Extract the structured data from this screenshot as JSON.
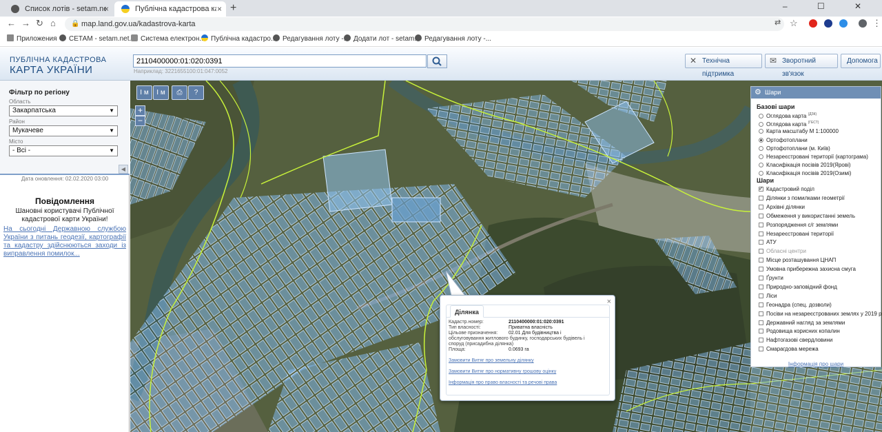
{
  "browser": {
    "tabs": [
      {
        "title": "Список лотів - setam.net.ua",
        "close": "×"
      },
      {
        "title": "Публічна кадастрова карта Укр",
        "close": "×"
      }
    ],
    "new_tab": "+",
    "window_controls": "–   ☐   ✕",
    "url": "map.land.gov.ua/kadastrova-karta",
    "bookmarks": [
      "Приложения",
      "СЕТАМ - setam.net...",
      "Система електрон...",
      "Публічна кадастро...",
      "Редагування лоту -...",
      "Додати лот - setam...",
      "Редагування лоту -..."
    ]
  },
  "header": {
    "logo_line1": "ПУБЛІЧНА КАДАСТРОВА",
    "logo_line2": "КАРТА УКРАЇНИ",
    "search_value": "2110400000:01:020:0391",
    "search_hint": "Наприклад: 3221655100:01:047:0052",
    "buttons": {
      "support": "Технічна підтримка",
      "feedback": "Зворотний зв'язок",
      "help": "Допомога"
    }
  },
  "filter": {
    "title": "Фільтр по регіону",
    "oblast_label": "Область",
    "oblast_value": "Закарпатська",
    "raion_label": "Район",
    "raion_value": "Мукачеве",
    "misto_label": "Місто",
    "misto_value": "- Всі -"
  },
  "update_date": "Дата оновлення: 02.02.2020 03:00",
  "notice": {
    "title": "Повідомлення",
    "greeting": "Шановні користувачі Публічної кадастрової карти України!",
    "body": "На сьогодні Державною службою України з питань геодезії, картографії та кадастру здійснюються заходи із виправлення помилок..."
  },
  "map_tools": [
    "I м",
    "I м",
    "⎙",
    "?"
  ],
  "zoom": {
    "in": "+",
    "out": "−"
  },
  "layers": {
    "title": "Шари",
    "base_title": "Базові шари",
    "base": [
      {
        "label": "Оглядова карта",
        "sup": "(ДЗК)",
        "on": false
      },
      {
        "label": "Оглядова карта",
        "sup": "(ГЕСТ)",
        "on": false
      },
      {
        "label": "Карта масштабу М 1:100000",
        "on": false
      },
      {
        "label": "Ортофотоплани",
        "on": true
      },
      {
        "label": "Ортофотоплани (м. Київ)",
        "on": false
      },
      {
        "label": "Незареєстровані території (картограма)",
        "on": false
      },
      {
        "label": "Класифікація посівів 2019(Ярові)",
        "on": false
      },
      {
        "label": "Класифікація посівів 2019(Озимі)",
        "on": false
      }
    ],
    "overlay_title": "Шари",
    "overlays": [
      {
        "label": "Кадастровий поділ",
        "on": true
      },
      {
        "label": "Ділянки з помилками геометрії",
        "on": false
      },
      {
        "label": "Архівні ділянки",
        "on": false
      },
      {
        "label": "Обмеження у використанні земель",
        "on": false
      },
      {
        "label": "Розпорядження с/г землями",
        "on": false
      },
      {
        "label": "Незареєстровані території",
        "on": false
      },
      {
        "label": "АТУ",
        "on": false
      },
      {
        "label": "Обласні центри",
        "on": false,
        "muted": true
      },
      {
        "label": "Місце розташування ЦНАП",
        "on": false
      },
      {
        "label": "Умовна прибережна захисна смуга",
        "on": false
      },
      {
        "label": "Ґрунти",
        "on": false
      },
      {
        "label": "Природно-заповідний фонд",
        "on": false
      },
      {
        "label": "Ліси",
        "on": false
      },
      {
        "label": "Геонадра (спец. дозволи)",
        "on": false
      },
      {
        "label": "Посіви на незареєстрованих землях у 2019 р.",
        "on": false
      },
      {
        "label": "Державний нагляд за землями",
        "on": false
      },
      {
        "label": "Родовища корисних копалин",
        "on": false
      },
      {
        "label": "Нафтогазові свердловини",
        "on": false
      },
      {
        "label": "Смарагдова мережа",
        "on": false
      }
    ],
    "info_link": "Інформація про шари"
  },
  "popup": {
    "tab": "Ділянка",
    "close": "×",
    "k_cad": "Кадастр.номер:",
    "v_cad": "2110400000:01:020:0391",
    "k_own": "Тип власності:",
    "v_own": "Приватна власність",
    "k_purpose": "Цільове призначення:",
    "v_purpose": "02.01 Для будівництва і",
    "purpose_cont1": "обслуговування житлового будинку, господарських будівель і",
    "purpose_cont2": "споруд (присадибна ділянка)",
    "k_area": "Площа:",
    "v_area": "0.0693 га",
    "link1": "Замовити Витяг про земельну ділянку",
    "link2": "Замовити Витяг про нормативну грошову оцінку",
    "link3": "Інформація про право власності та речові права"
  },
  "colors": {
    "parcel_fill": "#7fb6e8",
    "border_line": "#c8f23a",
    "header_blue": "#1e4d82",
    "link": "#4b74b6"
  }
}
